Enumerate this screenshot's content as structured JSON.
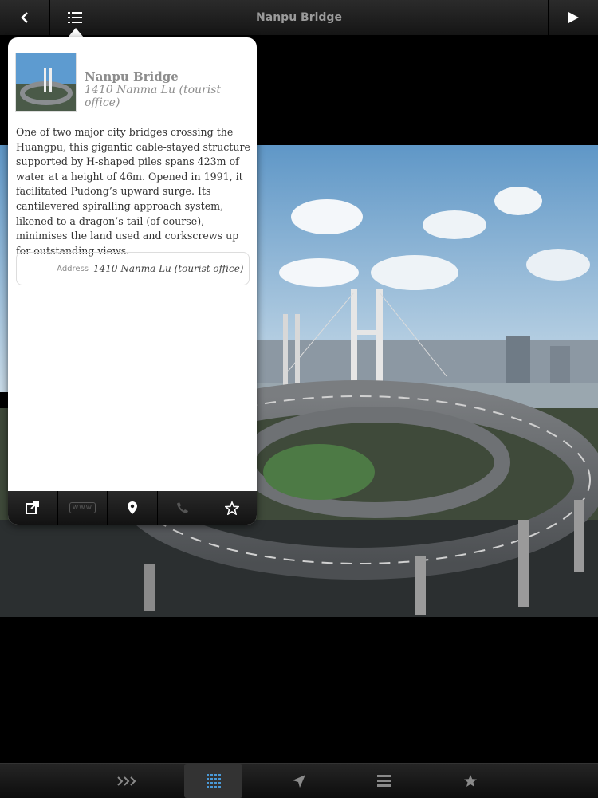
{
  "header": {
    "title": "Nanpu Bridge",
    "back_icon": "chevron-left-icon",
    "list_icon": "list-icon",
    "play_icon": "play-icon"
  },
  "popover": {
    "title": "Nanpu Bridge",
    "subtitle": "1410 Nanma Lu (tourist office)",
    "description": "One of two major city bridges crossing the Huangpu, this gigantic cable-stayed structure supported by H-shaped piles spans 423m of water at a height of 46m. Opened in 1991, it facilitated Pudong’s upward surge. Its cantilevered spiralling approach system, likened to a dragon’s tail (of course), minimises the land used and corkscrews up for outstanding views.",
    "address_label": "Address",
    "address_value": "1410 Nanma Lu (tourist office)",
    "toolbar": {
      "share_icon": "share-icon",
      "www_label": "www",
      "map_icon": "map-pin-icon",
      "phone_icon": "phone-icon",
      "favorite_icon": "star-icon"
    }
  },
  "bottom_nav": {
    "items": [
      {
        "name": "chevrons-icon"
      },
      {
        "name": "grid-icon",
        "active": true
      },
      {
        "name": "location-arrow-icon"
      },
      {
        "name": "list-icon"
      },
      {
        "name": "star-icon"
      }
    ]
  },
  "colors": {
    "bar_dark": "#151515",
    "popover_bg": "#ffffff",
    "title_gray": "#8d8d8d"
  }
}
